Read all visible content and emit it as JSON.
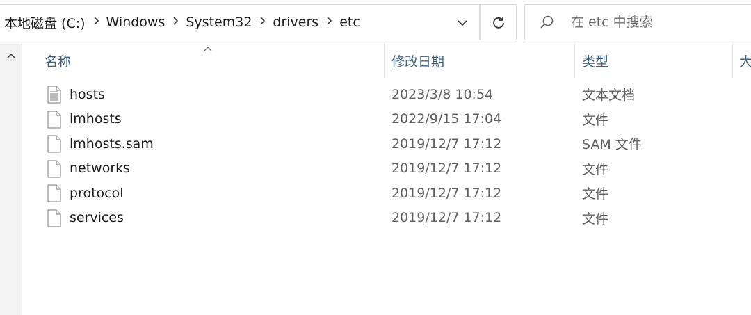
{
  "address_bar": {
    "crumbs": [
      "本地磁盘 (C:)",
      "Windows",
      "System32",
      "drivers",
      "etc"
    ]
  },
  "search": {
    "placeholder": "在 etc 中搜索"
  },
  "columns": {
    "name": "名称",
    "date": "修改日期",
    "type": "类型",
    "size_partial": "大"
  },
  "files": [
    {
      "name": "hosts",
      "date": "2023/3/8 10:54",
      "type": "文本文档",
      "icon": "text-file-icon"
    },
    {
      "name": "lmhosts",
      "date": "2022/9/15 17:04",
      "type": "文件",
      "icon": "file-icon"
    },
    {
      "name": "lmhosts.sam",
      "date": "2019/12/7 17:12",
      "type": "SAM 文件",
      "icon": "file-icon"
    },
    {
      "name": "networks",
      "date": "2019/12/7 17:12",
      "type": "文件",
      "icon": "file-icon"
    },
    {
      "name": "protocol",
      "date": "2019/12/7 17:12",
      "type": "文件",
      "icon": "file-icon"
    },
    {
      "name": "services",
      "date": "2019/12/7 17:12",
      "type": "文件",
      "icon": "file-icon"
    }
  ]
}
